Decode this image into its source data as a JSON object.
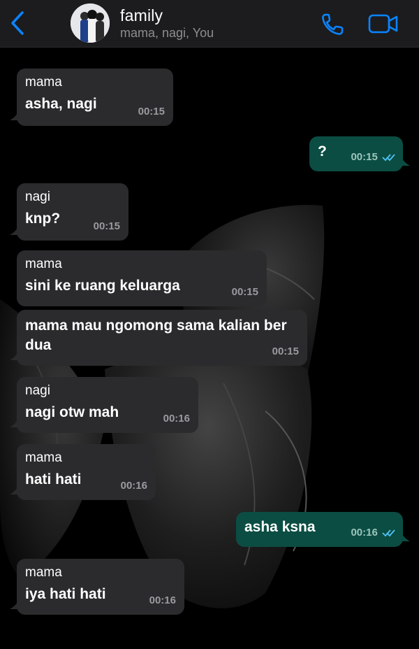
{
  "header": {
    "title": "family",
    "members": "mama, nagi, You"
  },
  "icons": {
    "back": "chevron-left-icon",
    "call": "phone-icon",
    "video": "video-camera-icon",
    "read": "double-check-icon"
  },
  "colors": {
    "accent": "#0a84ff",
    "incoming_bubble": "#2b2b2d",
    "outgoing_bubble": "#0b4d43",
    "read_tick": "#4fc3f7"
  },
  "messages": [
    {
      "sender": "mama",
      "text": "asha, nagi",
      "time": "00:15"
    },
    {
      "text": "?",
      "time": "00:15"
    },
    {
      "sender": "nagi",
      "text": "knp?",
      "time": "00:15"
    },
    {
      "sender": "mama",
      "text": "sini ke ruang keluarga",
      "time": "00:15"
    },
    {
      "text": "mama mau ngomong sama kalian ber dua",
      "time": "00:15"
    },
    {
      "sender": "nagi",
      "text": "nagi otw mah",
      "time": "00:16"
    },
    {
      "sender": "mama",
      "text": "hati hati",
      "time": "00:16"
    },
    {
      "text": "asha ksna",
      "time": "00:16"
    },
    {
      "sender": "mama",
      "text": "iya hati hati",
      "time": "00:16"
    }
  ]
}
